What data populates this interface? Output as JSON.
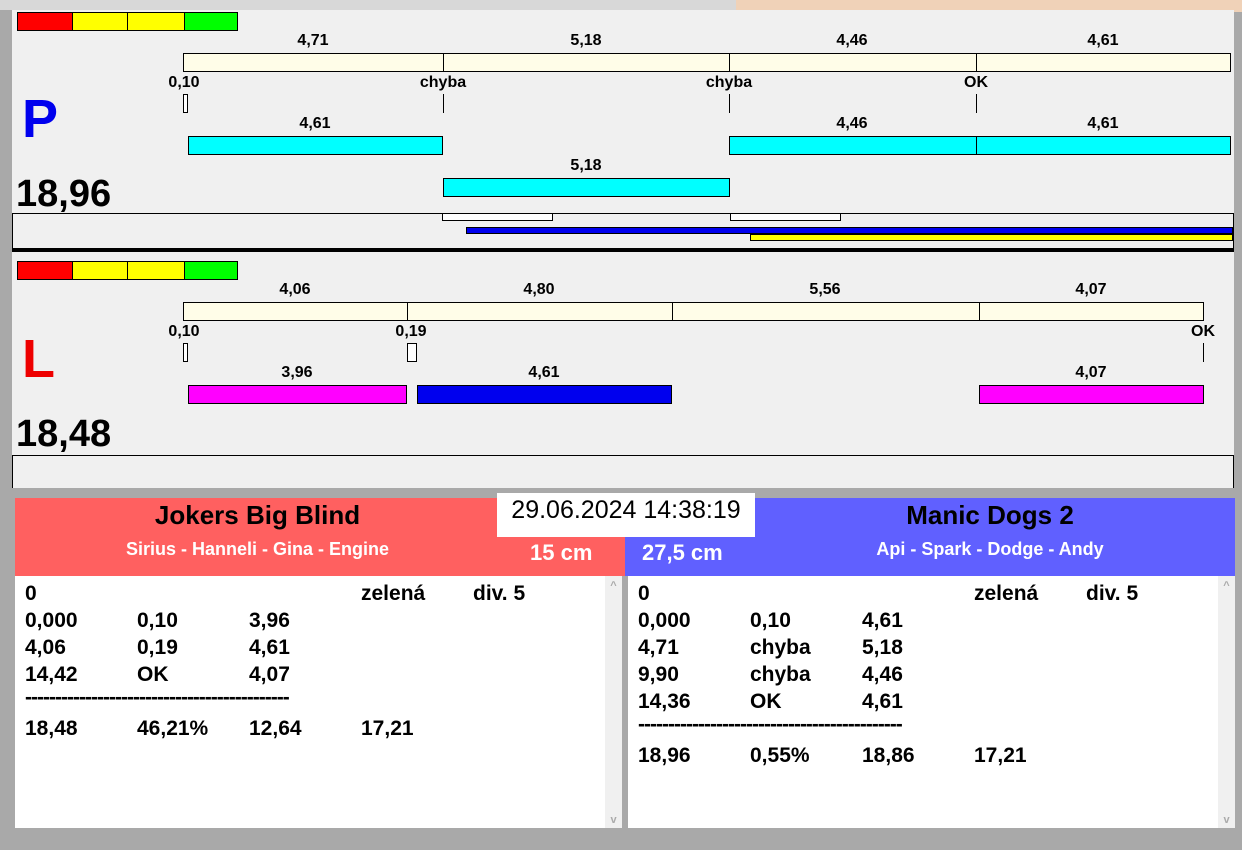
{
  "colors": {
    "red": "#ff0000",
    "yellow": "#ffff00",
    "green": "#00ff00",
    "cream": "#fffde8",
    "cyan": "#00ffff",
    "magenta": "#ff00ff",
    "blue": "#0000ff",
    "team_left": "#ff6060",
    "team_right": "#6060ff"
  },
  "p": {
    "label": "P",
    "total": "18,96",
    "top_segments": [
      "4,71",
      "5,18",
      "4,46",
      "4,61"
    ],
    "markers": [
      "0,10",
      "chyba",
      "chyba",
      "OK"
    ],
    "row1": [
      "4,61",
      "4,46",
      "4,61"
    ],
    "row2": [
      "5,18"
    ]
  },
  "l": {
    "label": "L",
    "total": "18,48",
    "top_segments": [
      "4,06",
      "4,80",
      "5,56",
      "4,07"
    ],
    "markers": [
      "0,10",
      "0,19",
      "OK"
    ],
    "row1": [
      "3,96",
      "4,61",
      "4,07"
    ]
  },
  "datetime": "29.06.2024 14:38:19",
  "left_team": {
    "name": "Jokers Big Blind",
    "dogs": "Sirius - Hanneli - Gina - Engine",
    "distance": "15 cm",
    "header": [
      "0",
      "",
      "",
      "zelená",
      "div. 5"
    ],
    "rows": [
      [
        "0,000",
        "0,10",
        "3,96"
      ],
      [
        "4,06",
        "0,19",
        "4,61"
      ],
      [
        "14,42",
        "OK",
        "4,07"
      ]
    ],
    "separator": "--------------------------------------------",
    "summary": [
      "18,48",
      "46,21%",
      "12,64",
      "17,21"
    ]
  },
  "right_team": {
    "name": "Manic Dogs 2",
    "dogs": "Api - Spark - Dodge - Andy",
    "distance": "27,5 cm",
    "header": [
      "0",
      "",
      "",
      "zelená",
      "div. 5"
    ],
    "rows": [
      [
        "0,000",
        "0,10",
        "4,61"
      ],
      [
        "4,71",
        "chyba",
        "5,18"
      ],
      [
        "9,90",
        "chyba",
        "4,46"
      ],
      [
        "14,36",
        "OK",
        "4,61"
      ]
    ],
    "separator": "--------------------------------------------",
    "summary": [
      "18,96",
      "0,55%",
      "18,86",
      "17,21"
    ]
  }
}
